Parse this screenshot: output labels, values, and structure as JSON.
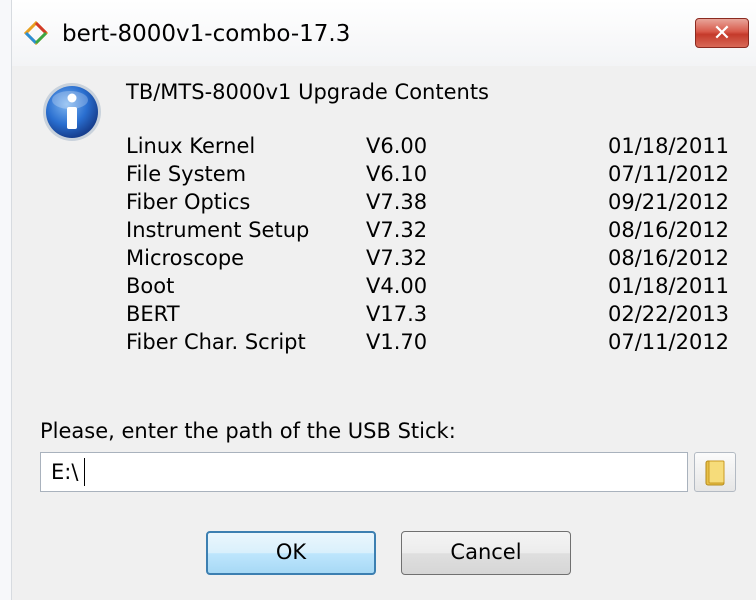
{
  "window": {
    "title": "bert-8000v1-combo-17.3",
    "close_label": "✕"
  },
  "dialog": {
    "heading": "TB/MTS-8000v1 Upgrade Contents",
    "components": [
      {
        "name": "Linux Kernel",
        "version": "V6.00",
        "date": "01/18/2011"
      },
      {
        "name": "File System",
        "version": "V6.10",
        "date": "07/11/2012"
      },
      {
        "name": "Fiber Optics",
        "version": "V7.38",
        "date": "09/21/2012"
      },
      {
        "name": "Instrument Setup",
        "version": "V7.32",
        "date": "08/16/2012"
      },
      {
        "name": "Microscope",
        "version": "V7.32",
        "date": "08/16/2012"
      },
      {
        "name": "Boot",
        "version": "V4.00",
        "date": "01/18/2011"
      },
      {
        "name": "BERT",
        "version": "V17.3",
        "date": "02/22/2013"
      },
      {
        "name": "Fiber Char. Script",
        "version": "V1.70",
        "date": "07/11/2012"
      }
    ],
    "prompt": "Please, enter the path of the USB Stick:",
    "path_value": "E:\\",
    "ok_label": "OK",
    "cancel_label": "Cancel"
  },
  "icons": {
    "app": "app-logo-icon",
    "info": "info-icon",
    "browse": "folder-icon"
  },
  "colors": {
    "close_button": "#c43a2b",
    "ok_border": "#3c7fb1",
    "info_blue": "#1f5fb8"
  }
}
